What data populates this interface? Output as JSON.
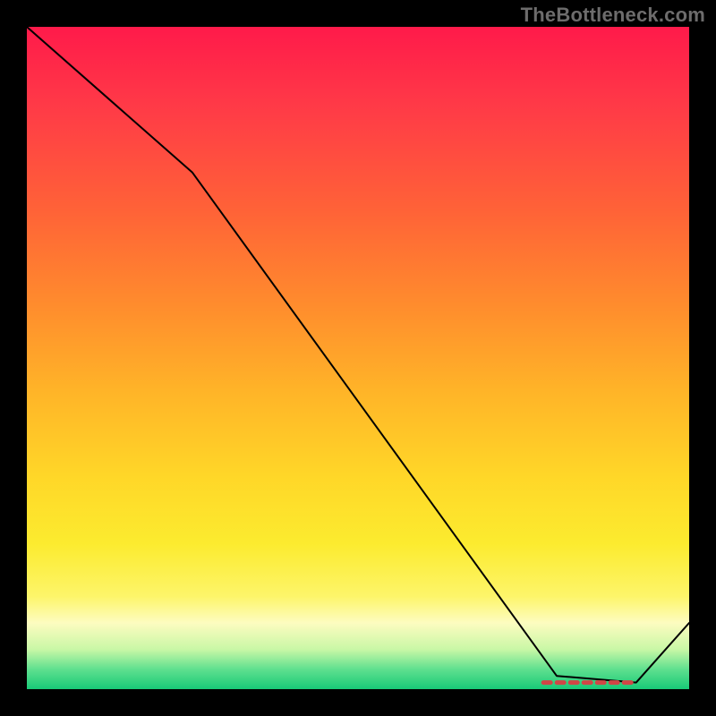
{
  "watermark": "TheBottleneck.com",
  "chart_data": {
    "type": "line",
    "title": "",
    "xlabel": "",
    "ylabel": "",
    "xlim": [
      0,
      100
    ],
    "ylim": [
      0,
      100
    ],
    "gradient_bands": [
      {
        "label": "red",
        "center_pct": 10
      },
      {
        "label": "orange",
        "center_pct": 45
      },
      {
        "label": "yellow",
        "center_pct": 75
      },
      {
        "label": "pale",
        "center_pct": 90
      },
      {
        "label": "green",
        "center_pct": 98
      }
    ],
    "series": [
      {
        "name": "bottleneck-curve",
        "x": [
          0,
          25,
          80,
          92,
          100
        ],
        "values": [
          100,
          78,
          2,
          1,
          10
        ]
      }
    ],
    "hot_region": {
      "name": "optimal-range-markers",
      "x_start": 78,
      "x_end": 92,
      "y": 1
    }
  }
}
